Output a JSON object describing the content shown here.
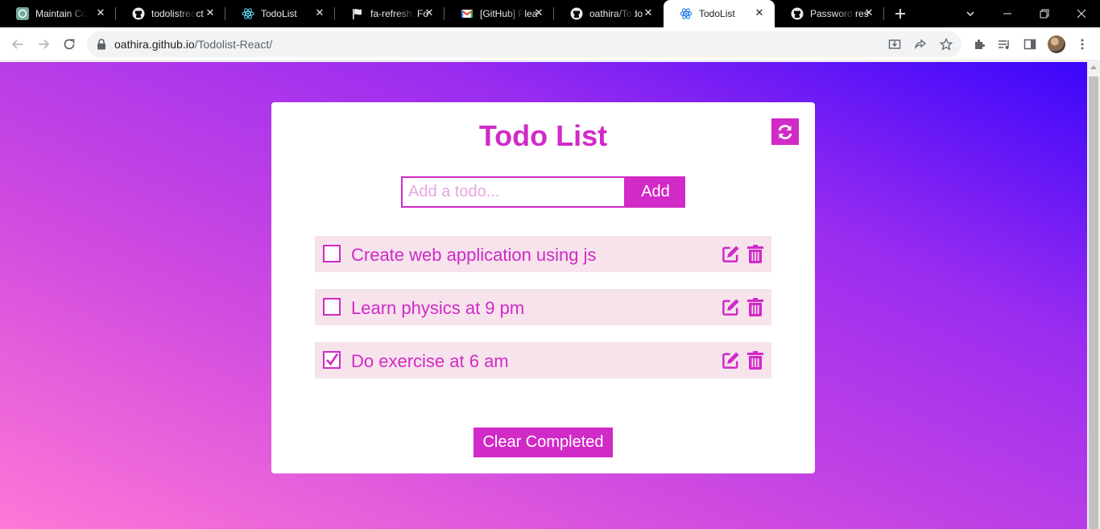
{
  "browser": {
    "tabs": [
      {
        "title": "Maintain Co",
        "icon": "chatgpt-icon"
      },
      {
        "title": "todolistreact",
        "icon": "github-icon"
      },
      {
        "title": "TodoList",
        "icon": "react-icon"
      },
      {
        "title": "fa-refresh: Fo",
        "icon": "flag-icon"
      },
      {
        "title": "[GitHub] Plea",
        "icon": "gmail-icon"
      },
      {
        "title": "oathira/Todo",
        "icon": "github-icon"
      },
      {
        "title": "TodoList",
        "icon": "react-icon",
        "active": true
      },
      {
        "title": "Password res",
        "icon": "github-icon"
      }
    ],
    "url_host": "oathira.github.io",
    "url_path": "/Todolist-React/"
  },
  "app": {
    "title": "Todo List",
    "input_placeholder": "Add a todo...",
    "input_value": "",
    "add_label": "Add",
    "todos": [
      {
        "text": "Create web application using js",
        "completed": false
      },
      {
        "text": "Learn physics at 9 pm",
        "completed": false
      },
      {
        "text": "Do exercise at 6 am",
        "completed": true
      }
    ],
    "clear_label": "Clear Completed"
  },
  "colors": {
    "accent": "#d12ac7",
    "item_bg": "#f6e3ec",
    "gradient_start": "#ff77d6",
    "gradient_end": "#3a06fb"
  }
}
